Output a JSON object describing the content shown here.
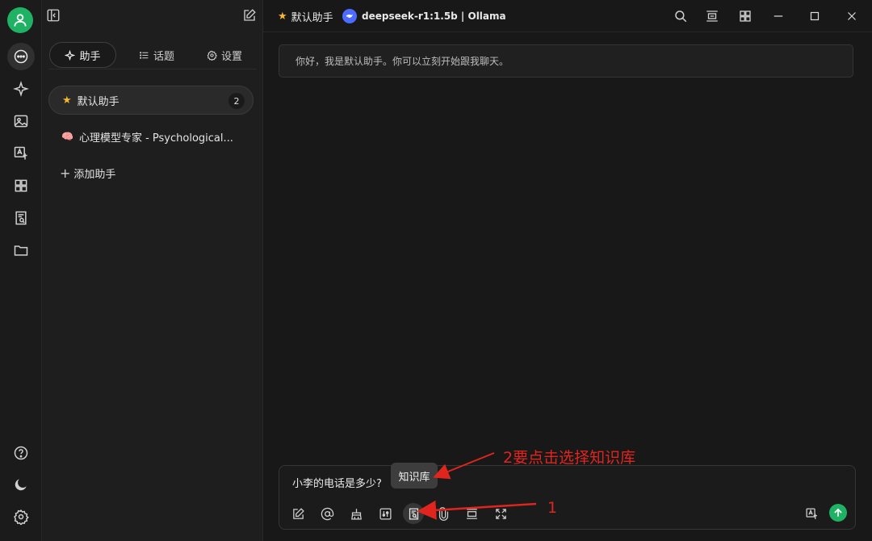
{
  "sidebar_tabs": {
    "assistants": "助手",
    "topics": "话题",
    "settings": "设置"
  },
  "assistants": [
    {
      "label": "默认助手",
      "count": "2"
    },
    {
      "label": "心理模型专家 - Psychological..."
    }
  ],
  "add_assistant": "添加助手",
  "header": {
    "assistant_title": "默认助手",
    "model_label": "deepseek-r1:1.5b | Ollama"
  },
  "chat": {
    "welcome_message": "你好，我是默认助手。你可以立刻开始跟我聊天。",
    "input_text": "小李的电话是多少?",
    "tooltip": "知识库"
  },
  "annotations": {
    "step2": "2要点击选择知识库",
    "step1": "1"
  },
  "colors": {
    "accent": "#1fb264",
    "annotation": "#e0251f",
    "star": "#f5b82e"
  },
  "icons": {
    "rail": [
      "user-icon",
      "chat-icon",
      "sparkle-icon",
      "image-icon",
      "translate-icon",
      "apps-icon",
      "knowledge-icon",
      "folder-icon",
      "help-icon",
      "moon-icon",
      "gear-icon"
    ],
    "toolbar": [
      "edit-icon",
      "at-icon",
      "broom-icon",
      "params-icon",
      "knowledge-icon",
      "paperclip-icon",
      "layout-icon",
      "expand-icon"
    ]
  }
}
